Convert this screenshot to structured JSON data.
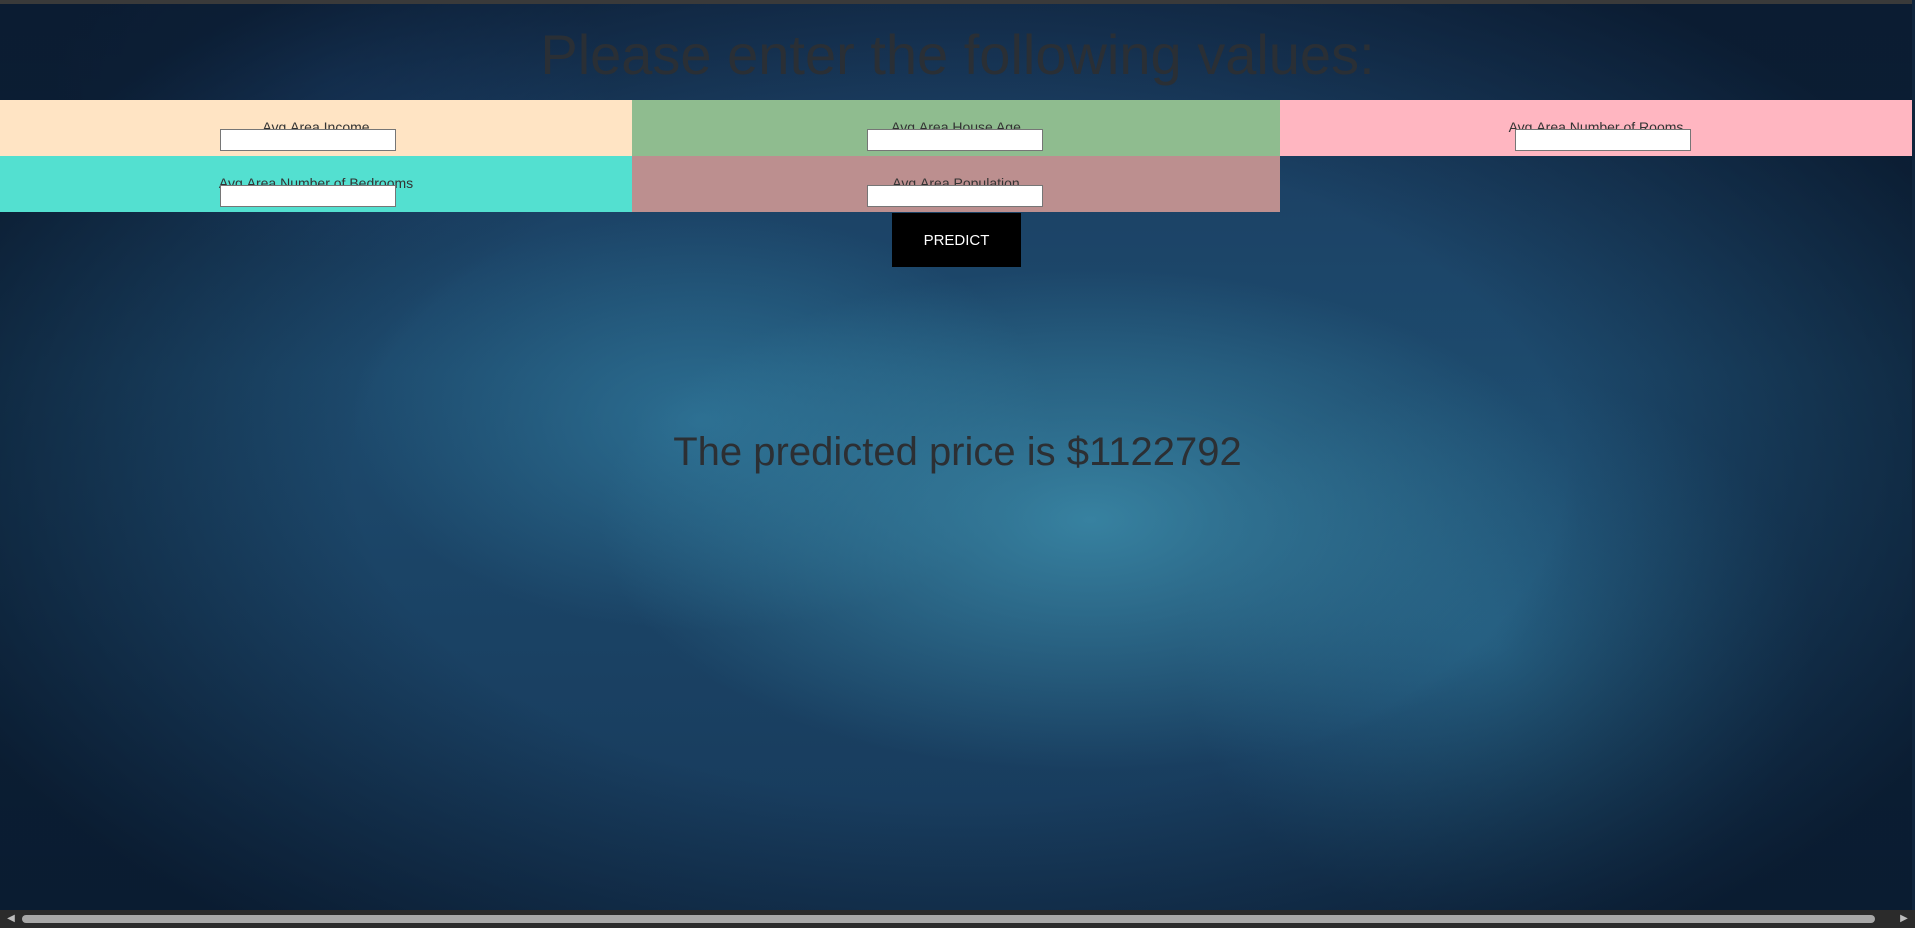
{
  "heading": "Please enter the following values:",
  "fields": [
    {
      "label": "Avg.Area Income",
      "value": "",
      "color": "#ffe4c4"
    },
    {
      "label": "Avg.Area House Age",
      "value": "",
      "color": "#8fbc8f"
    },
    {
      "label": "Avg.Area Number of Rooms",
      "value": "",
      "color": "#ffb6c1"
    },
    {
      "label": "Avg.Area Number of Bedrooms",
      "value": "",
      "color": "#53e0d0"
    },
    {
      "label": "Avg.Area Population",
      "value": "",
      "color": "#bc8f8f"
    }
  ],
  "predict_button": {
    "label": "PREDICT"
  },
  "result_text": "The predicted price is $1122792",
  "scrollbar": {
    "left_arrow": "left-arrow-icon",
    "right_arrow": "right-arrow-icon"
  }
}
